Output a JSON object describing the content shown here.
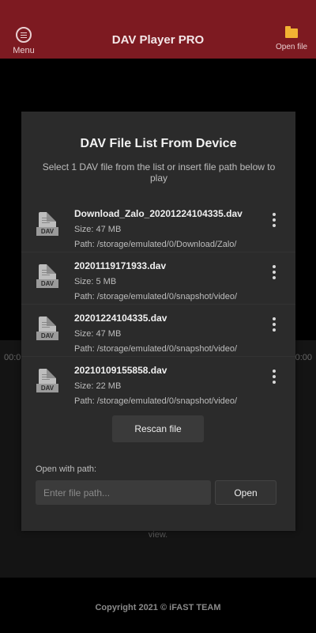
{
  "topbar": {
    "title": "DAV Player PRO",
    "menu_label": "Menu",
    "open_file_label": "Open file",
    "color": "#7d1a21"
  },
  "background": {
    "time_left": "00:0",
    "time_right": "0:00",
    "view_text": "view.",
    "copyright": "Copyright 2021 © iFAST TEAM"
  },
  "dialog": {
    "title": "DAV File List From Device",
    "subtitle": "Select 1 DAV file from the list or insert file path below to play",
    "files": [
      {
        "icon_tag": "DAV",
        "name": "Download_Zalo_20201224104335.dav",
        "size": "Size: 47 MB",
        "path": "Path: /storage/emulated/0/Download/Zalo/"
      },
      {
        "icon_tag": "DAV",
        "name": "20201119171933.dav",
        "size": "Size: 5 MB",
        "path": "Path: /storage/emulated/0/snapshot/video/"
      },
      {
        "icon_tag": "DAV",
        "name": "20201224104335.dav",
        "size": "Size: 47 MB",
        "path": "Path: /storage/emulated/0/snapshot/video/"
      },
      {
        "icon_tag": "DAV",
        "name": "20210109155858.dav",
        "size": "Size: 22 MB",
        "path": "Path: /storage/emulated/0/snapshot/video/"
      }
    ],
    "rescan_label": "Rescan file",
    "path_label": "Open with path:",
    "path_placeholder": "Enter file path...",
    "open_label": "Open"
  }
}
